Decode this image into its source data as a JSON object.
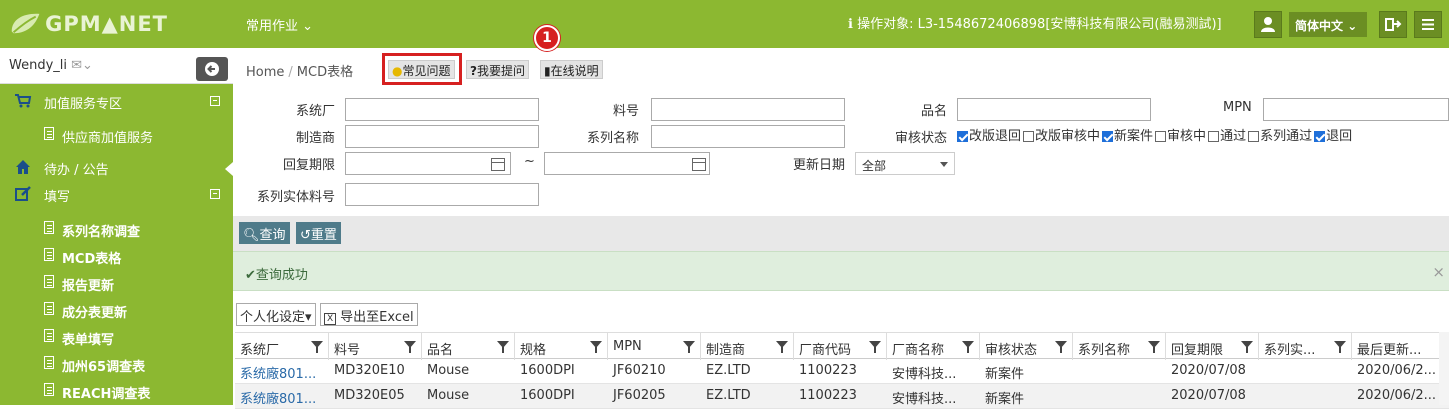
{
  "header": {
    "logo_text": "GPM▲NET",
    "menu_common": "常用作业",
    "target_label": "操作对象: L3-1548672406898[安博科技有限公司(融易测試)]",
    "language": "简体中文"
  },
  "sidebar": {
    "user": "Wendy_li",
    "items": [
      {
        "label": "加值服务专区",
        "type": "group"
      },
      {
        "label": "供应商加值服务",
        "type": "sub"
      },
      {
        "label": "待办 / 公告",
        "type": "group"
      },
      {
        "label": "填写",
        "type": "group"
      },
      {
        "label": "系列名称调查",
        "type": "sub"
      },
      {
        "label": "MCD表格",
        "type": "sub"
      },
      {
        "label": "报告更新",
        "type": "sub"
      },
      {
        "label": "成分表更新",
        "type": "sub"
      },
      {
        "label": "表单填写",
        "type": "sub"
      },
      {
        "label": "加州65调查表",
        "type": "sub"
      },
      {
        "label": "REACH调查表",
        "type": "sub"
      }
    ]
  },
  "breadcrumb": {
    "home": "Home",
    "sep": "/",
    "current": "MCD表格"
  },
  "help_buttons": {
    "faq": "常见问题",
    "ask": "我要提问",
    "online": "在线说明",
    "callout": "1"
  },
  "form": {
    "system_factory": "系统厂",
    "part_no": "料号",
    "product_name": "品名",
    "mpn": "MPN",
    "manufacturer": "制造商",
    "series_name": "系列名称",
    "review_status": "审核状态",
    "reply_deadline": "回复期限",
    "tilde": "~",
    "update_date": "更新日期",
    "update_date_value": "全部",
    "series_entity_part": "系列实体料号",
    "status_options": [
      {
        "label": "改版退回",
        "checked": true
      },
      {
        "label": "改版审核中",
        "checked": false
      },
      {
        "label": "新案件",
        "checked": true
      },
      {
        "label": "审核中",
        "checked": false
      },
      {
        "label": "通过",
        "checked": false
      },
      {
        "label": "系列通过",
        "checked": false
      },
      {
        "label": "退回",
        "checked": true
      }
    ]
  },
  "toolbar": {
    "query": "查询",
    "reset": "重置"
  },
  "alert": {
    "message": "查询成功",
    "close": "×"
  },
  "grid_tools": {
    "personalize": "个人化设定",
    "export": "导出至Excel"
  },
  "table": {
    "columns": [
      "系统厂",
      "料号",
      "品名",
      "规格",
      "MPN",
      "制造商",
      "厂商代码",
      "厂商名称",
      "审核状态",
      "系列名称",
      "回复期限",
      "系列实...",
      "最后更新..."
    ],
    "rows": [
      [
        "系统廠801...",
        "MD320E10",
        "Mouse",
        "1600DPI",
        "JF60210",
        "EZ.LTD",
        "1100223",
        "安博科技...",
        "新案件",
        "",
        "2020/07/08",
        "",
        "2020/06/2..."
      ],
      [
        "系统廠801...",
        "MD320E05",
        "Mouse",
        "1600DPI",
        "JF60205",
        "EZ.LTD",
        "1100223",
        "安博科技...",
        "新案件",
        "",
        "2020/07/08",
        "",
        "2020/06/2..."
      ]
    ]
  }
}
